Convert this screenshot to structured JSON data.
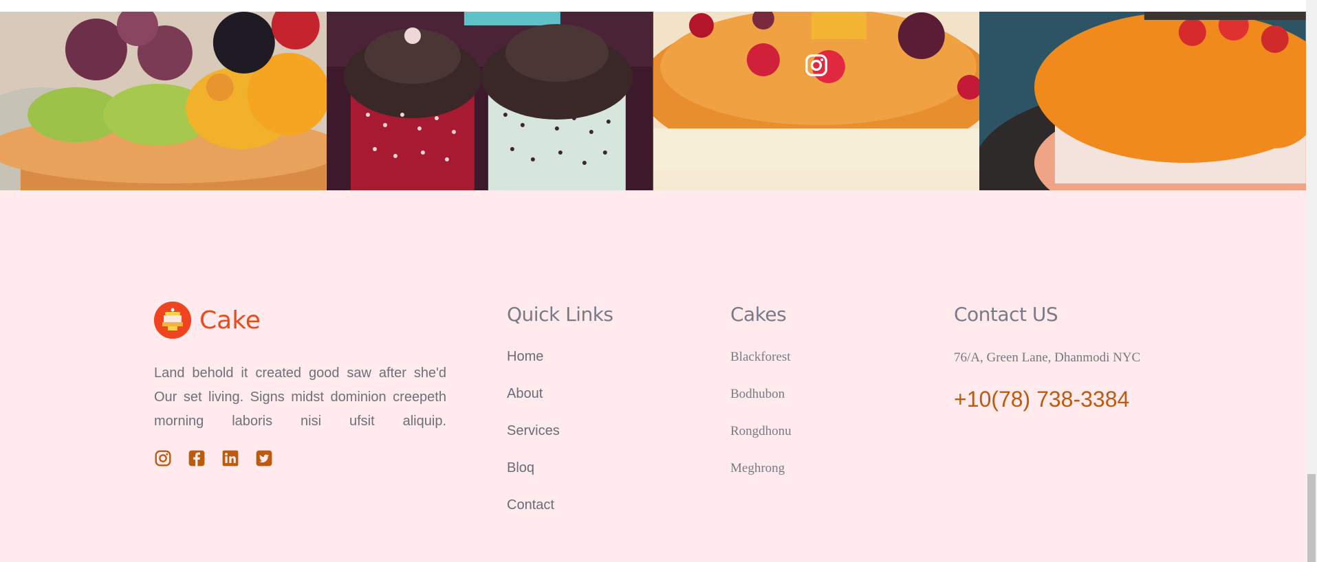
{
  "gallery": {
    "tiles": [
      {
        "name": "fruit-tart"
      },
      {
        "name": "chocolate-cupcakes"
      },
      {
        "name": "berry-cheesecake"
      },
      {
        "name": "orange-glazed-cake"
      }
    ],
    "overlay_icon": "instagram-icon"
  },
  "footer": {
    "brand": {
      "name": "Cake",
      "logo_icon": "cake-logo-icon"
    },
    "about": "Land behold it created good saw after she'd Our set living. Signs midst dominion creepeth morning laboris nisi ufsit aliquip.",
    "socials": [
      {
        "icon": "instagram-icon"
      },
      {
        "icon": "facebook-icon"
      },
      {
        "icon": "linkedin-icon"
      },
      {
        "icon": "twitter-icon"
      }
    ],
    "quick_links": {
      "title": "Quick Links",
      "items": [
        "Home",
        "About",
        "Services",
        "Bloq",
        "Contact"
      ]
    },
    "cakes": {
      "title": "Cakes",
      "items": [
        "Blackforest",
        "Bodhubon",
        "Rongdhonu",
        "Meghrong"
      ]
    },
    "contact": {
      "title": "Contact US",
      "address": "76/A, Green Lane, Dhanmodi NYC",
      "phone": "+10(78) 738-3384"
    }
  },
  "colors": {
    "footer_bg": "#ffebed",
    "brand": "#e84b1c",
    "accent": "#bc5a0e",
    "text_muted": "#6f6f78"
  }
}
